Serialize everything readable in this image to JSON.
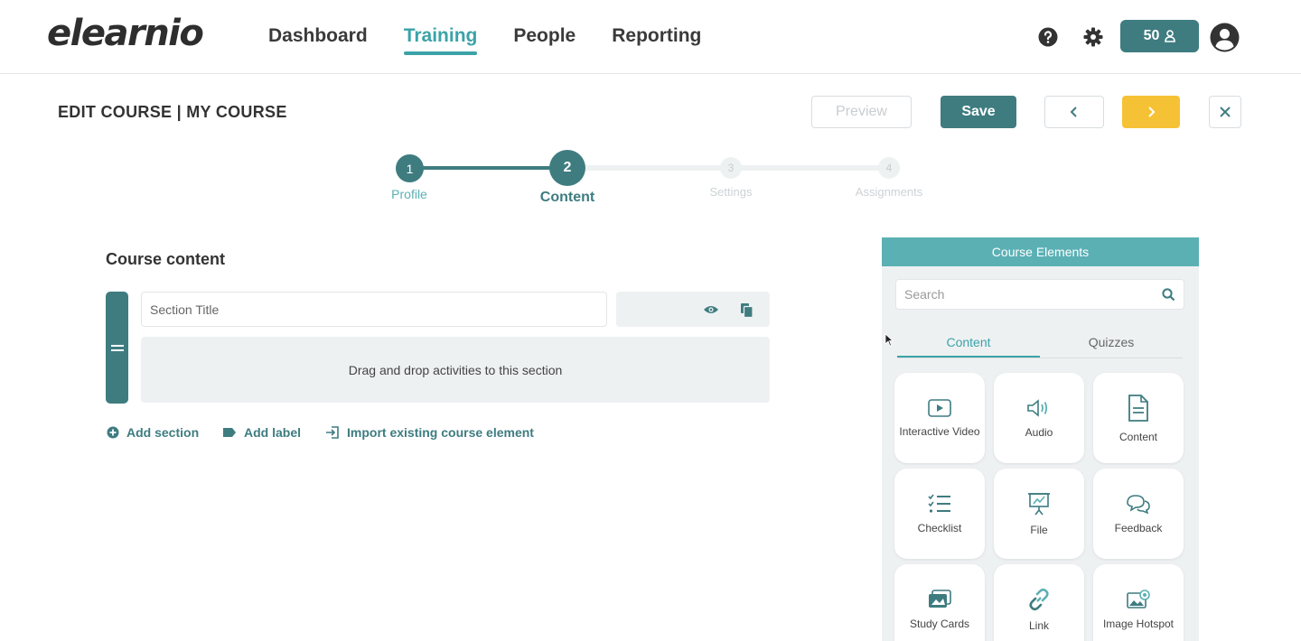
{
  "header": {
    "logo": "elearnio",
    "nav": [
      "Dashboard",
      "Training",
      "People",
      "Reporting"
    ],
    "active_nav": "Training",
    "credits": "50",
    "accent_color": "#3ba3a8",
    "primary_color": "#3e7c80"
  },
  "toolbar": {
    "title": "EDIT COURSE | MY COURSE",
    "preview_label": "Preview",
    "save_label": "Save",
    "prev_icon": "chevron-left-icon",
    "next_icon": "chevron-right-icon",
    "close_icon": "close-icon",
    "next_color": "#f6c235"
  },
  "stepper": {
    "steps": [
      {
        "number": "1",
        "label": "Profile",
        "state": "complete"
      },
      {
        "number": "2",
        "label": "Content",
        "state": "current"
      },
      {
        "number": "3",
        "label": "Settings",
        "state": "upcoming"
      },
      {
        "number": "4",
        "label": "Assignments",
        "state": "upcoming"
      }
    ]
  },
  "content": {
    "heading": "Course content",
    "section_title_placeholder": "Section Title",
    "dropzone_text": "Drag and drop activities to this section",
    "actions": [
      "Add section",
      "Add label",
      "Import existing course element"
    ]
  },
  "elements_panel": {
    "title": "Course Elements",
    "search_placeholder": "Search",
    "tabs": [
      "Content",
      "Quizzes"
    ],
    "active_tab": "Content",
    "items": [
      {
        "label": "Interactive Video",
        "icon": "video-icon"
      },
      {
        "label": "Audio",
        "icon": "speaker-icon"
      },
      {
        "label": "Content",
        "icon": "document-icon"
      },
      {
        "label": "Checklist",
        "icon": "checklist-icon"
      },
      {
        "label": "File",
        "icon": "presentation-icon"
      },
      {
        "label": "Feedback",
        "icon": "chat-bubbles-icon"
      },
      {
        "label": "Study Cards",
        "icon": "cards-icon"
      },
      {
        "label": "Link",
        "icon": "link-icon"
      },
      {
        "label": "Image Hotspot",
        "icon": "image-hotspot-icon"
      }
    ]
  }
}
